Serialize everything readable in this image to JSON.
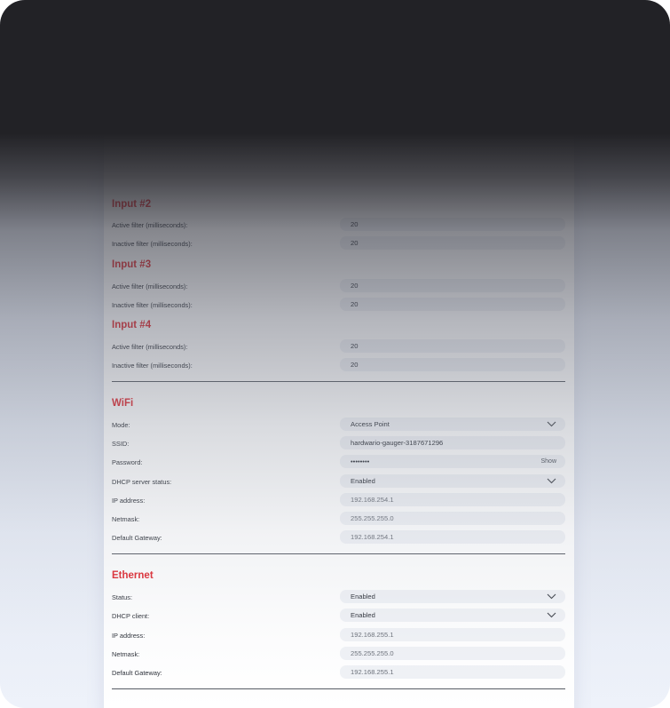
{
  "inputs": [
    {
      "title": "Input #2",
      "active_label": "Active filter (milliseconds):",
      "active_value": "20",
      "inactive_label": "Inactive filter (milliseconds):",
      "inactive_value": "20"
    },
    {
      "title": "Input #3",
      "active_label": "Active filter (milliseconds):",
      "active_value": "20",
      "inactive_label": "Inactive filter (milliseconds):",
      "inactive_value": "20"
    },
    {
      "title": "Input #4",
      "active_label": "Active filter (milliseconds):",
      "active_value": "20",
      "inactive_label": "Inactive filter (milliseconds):",
      "inactive_value": "20"
    }
  ],
  "wifi": {
    "title": "WiFi",
    "mode_label": "Mode:",
    "mode_value": "Access Point",
    "ssid_label": "SSID:",
    "ssid_value": "hardwario-gauger-3187671296",
    "password_label": "Password:",
    "password_value": "••••••••",
    "show_label": "Show",
    "dhcp_label": "DHCP server status:",
    "dhcp_value": "Enabled",
    "ip_label": "IP address:",
    "ip_value": "192.168.254.1",
    "netmask_label": "Netmask:",
    "netmask_value": "255.255.255.0",
    "gateway_label": "Default Gateway:",
    "gateway_value": "192.168.254.1"
  },
  "ethernet": {
    "title": "Ethernet",
    "status_label": "Status:",
    "status_value": "Enabled",
    "dhcp_label": "DHCP client:",
    "dhcp_value": "Enabled",
    "ip_label": "IP address:",
    "ip_value": "192.168.255.1",
    "netmask_label": "Netmask:",
    "netmask_value": "255.255.255.0",
    "gateway_label": "Default Gateway:",
    "gateway_value": "192.168.255.1"
  },
  "colors": {
    "accent": "#e0262e",
    "field_bg": "#f0f2f6",
    "overlay": "#222226"
  }
}
